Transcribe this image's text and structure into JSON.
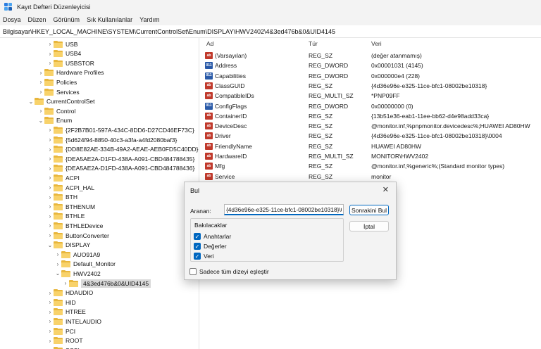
{
  "window": {
    "title": "Kayıt Defteri Düzenleyicisi",
    "accent": "#0067c0"
  },
  "menu": [
    "Dosya",
    "Düzen",
    "Görünüm",
    "Sık Kullanılanlar",
    "Yardım"
  ],
  "address": "Bilgisayar\\HKEY_LOCAL_MACHINE\\SYSTEM\\CurrentControlSet\\Enum\\DISPLAY\\HWV2402\\4&3ed476b&0&UID4145",
  "tree": [
    {
      "label": "USB",
      "level": 3,
      "chevron": ">"
    },
    {
      "label": "USB4",
      "level": 3,
      "chevron": ">"
    },
    {
      "label": "USBSTOR",
      "level": 3,
      "chevron": ">"
    },
    {
      "label": "Hardware Profiles",
      "level": 2,
      "chevron": ">"
    },
    {
      "label": "Policies",
      "level": 2,
      "chevron": ">"
    },
    {
      "label": "Services",
      "level": 2,
      "chevron": ">"
    },
    {
      "label": "CurrentControlSet",
      "level": 1,
      "chevron": "v"
    },
    {
      "label": "Control",
      "level": 2,
      "chevron": ">"
    },
    {
      "label": "Enum",
      "level": 2,
      "chevron": "v"
    },
    {
      "label": "{2F2B7B01-597A-434C-8DD6-D27CD46EF73C}",
      "level": 3,
      "chevron": ">"
    },
    {
      "label": "{5d624f94-8850-40c3-a3fa-a4fd2080baf3}",
      "level": 3,
      "chevron": ">"
    },
    {
      "label": "{DD8E82AE-334B-49A2-AEAE-AEB0FD5C40DD}",
      "level": 3,
      "chevron": ">"
    },
    {
      "label": "{DEA5AE2A-D1FD-438A-A091-CBD484788435}",
      "level": 3,
      "chevron": ">"
    },
    {
      "label": "{DEA5AE2A-D1FD-438A-A091-CBD484788436}",
      "level": 3,
      "chevron": ">"
    },
    {
      "label": "ACPI",
      "level": 3,
      "chevron": ">"
    },
    {
      "label": "ACPI_HAL",
      "level": 3,
      "chevron": ">"
    },
    {
      "label": "BTH",
      "level": 3,
      "chevron": ">"
    },
    {
      "label": "BTHENUM",
      "level": 3,
      "chevron": ">"
    },
    {
      "label": "BTHLE",
      "level": 3,
      "chevron": ">"
    },
    {
      "label": "BTHLEDevice",
      "level": 3,
      "chevron": ">"
    },
    {
      "label": "ButtonConverter",
      "level": 3,
      "chevron": ">"
    },
    {
      "label": "DISPLAY",
      "level": 3,
      "chevron": "v"
    },
    {
      "label": "AUO91A9",
      "level": 4,
      "chevron": ">"
    },
    {
      "label": "Default_Monitor",
      "level": 4,
      "chevron": ">"
    },
    {
      "label": "HWV2402",
      "level": 4,
      "chevron": "v"
    },
    {
      "label": "4&3ed476b&0&UID4145",
      "level": 5,
      "chevron": ">",
      "selected": true
    },
    {
      "label": "HDAUDIO",
      "level": 3,
      "chevron": ">"
    },
    {
      "label": "HID",
      "level": 3,
      "chevron": ">"
    },
    {
      "label": "HTREE",
      "level": 3,
      "chevron": ">"
    },
    {
      "label": "INTELAUDIO",
      "level": 3,
      "chevron": ">"
    },
    {
      "label": "PCI",
      "level": 3,
      "chevron": ">"
    },
    {
      "label": "ROOT",
      "level": 3,
      "chevron": ">"
    },
    {
      "label": "SCSI",
      "level": 3,
      "chevron": ">"
    }
  ],
  "values_header": {
    "name": "Ad",
    "type": "Tür",
    "data": "Veri"
  },
  "values": [
    {
      "icon": "string-icon",
      "name": "(Varsayılan)",
      "type": "REG_SZ",
      "data": "(değer atanmamış)"
    },
    {
      "icon": "binary-icon",
      "name": "Address",
      "type": "REG_DWORD",
      "data": "0x00001031 (4145)"
    },
    {
      "icon": "binary-icon",
      "name": "Capabilities",
      "type": "REG_DWORD",
      "data": "0x000000e4 (228)"
    },
    {
      "icon": "string-icon",
      "name": "ClassGUID",
      "type": "REG_SZ",
      "data": "{4d36e96e-e325-11ce-bfc1-08002be10318}"
    },
    {
      "icon": "string-icon",
      "name": "CompatibleIDs",
      "type": "REG_MULTI_SZ",
      "data": "*PNP09FF"
    },
    {
      "icon": "binary-icon",
      "name": "ConfigFlags",
      "type": "REG_DWORD",
      "data": "0x00000000 (0)"
    },
    {
      "icon": "string-icon",
      "name": "ContainerID",
      "type": "REG_SZ",
      "data": "{13b51e36-eab1-11ee-bb62-d4e98add33ca}"
    },
    {
      "icon": "string-icon",
      "name": "DeviceDesc",
      "type": "REG_SZ",
      "data": "@monitor.inf,%pnpmonitor.devicedesc%;HUAWEI AD80HW"
    },
    {
      "icon": "string-icon",
      "name": "Driver",
      "type": "REG_SZ",
      "data": "{4d36e96e-e325-11ce-bfc1-08002be10318}\\0004",
      "selected": true
    },
    {
      "icon": "string-icon",
      "name": "FriendlyName",
      "type": "REG_SZ",
      "data": "HUAWEI AD80HW"
    },
    {
      "icon": "string-icon",
      "name": "HardwareID",
      "type": "REG_MULTI_SZ",
      "data": "MONITOR\\HWV2402"
    },
    {
      "icon": "string-icon",
      "name": "Mfg",
      "type": "REG_SZ",
      "data": "@monitor.inf,%generic%;(Standard monitor types)"
    },
    {
      "icon": "string-icon",
      "name": "Service",
      "type": "REG_SZ",
      "data": "monitor"
    }
  ],
  "find_dialog": {
    "title": "Bul",
    "search_label": "Aranan:",
    "search_value": "{4d36e96e-e325-11ce-bfc1-08002be10318}\\0",
    "find_next": "Sonrakini Bul",
    "cancel": "İptal",
    "look_at": "Bakılacaklar",
    "keys": "Anahtarlar",
    "values": "Değerler",
    "data": "Veri",
    "match_whole": "Sadece tüm dizeyi eşleştir",
    "keys_checked": true,
    "values_checked": true,
    "data_checked": true,
    "match_checked": false
  }
}
